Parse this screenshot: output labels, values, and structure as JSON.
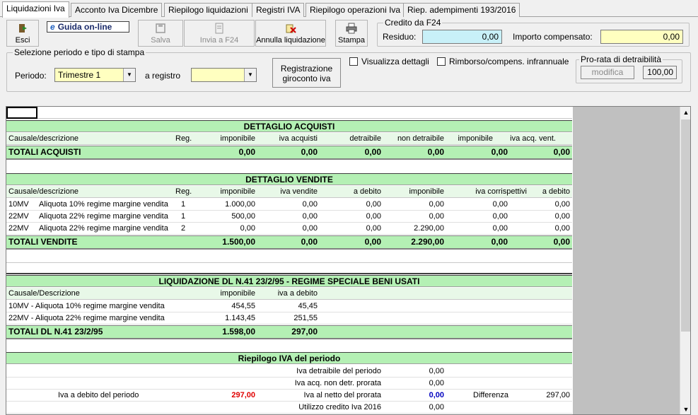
{
  "tabs": [
    {
      "label": "Liquidazioni Iva"
    },
    {
      "label": "Acconto Iva Dicembre"
    },
    {
      "label": "Riepilogo liquidazioni"
    },
    {
      "label": "Registri IVA"
    },
    {
      "label": "Riepilogo operazioni Iva"
    },
    {
      "label": "Riep. adempimenti 193/2016"
    }
  ],
  "toolbar": {
    "esci": "Esci",
    "guida": "Guida on-line",
    "guida_icon": "e",
    "salva": "Salva",
    "invia": "Invia a F24",
    "annulla": "Annulla liquidazione",
    "stampa": "Stampa"
  },
  "credito": {
    "title": "Credito da F24",
    "residuo_label": "Residuo:",
    "residuo_value": "0,00",
    "importo_label": "Importo compensato:",
    "importo_value": "0,00"
  },
  "selezione": {
    "title": "Selezione periodo e tipo di stampa",
    "periodo_label": "Periodo:",
    "periodo_value": "Trimestre 1",
    "registro_label": "a registro",
    "registro_value": "",
    "registrazione_btn_1": "Registrazione",
    "registrazione_btn_2": "giroconto iva",
    "visualizza": "Visualizza dettagli",
    "rimborso": "Rimborso/compens. infrannuale",
    "prorata_title": "Pro-rata di detraibilità",
    "modifica": "modifica",
    "prorata_value": "100,00"
  },
  "acquisti": {
    "title": "DETTAGLIO ACQUISTI",
    "headers": [
      "Causale/descrizione",
      "Reg.",
      "imponibile",
      "iva acquisti",
      "detraibile",
      "non detraibile",
      "imponibile",
      "iva acq. vent."
    ],
    "totals": [
      "TOTALI ACQUISTI",
      "0,00",
      "0,00",
      "0,00",
      "0,00",
      "0,00",
      "0,00"
    ]
  },
  "vendite": {
    "title": "DETTAGLIO VENDITE",
    "headers": [
      "Causale/descrizione",
      "Reg.",
      "imponibile",
      "iva vendite",
      "a debito",
      "imponibile",
      "iva corrispettivi",
      "a debito"
    ],
    "rows": [
      [
        "10MV",
        "Aliquota 10% regime margine vendita",
        "1",
        "1.000,00",
        "0,00",
        "0,00",
        "0,00",
        "0,00",
        "0,00"
      ],
      [
        "22MV",
        "Aliquota 22% regime margine vendita",
        "1",
        "500,00",
        "0,00",
        "0,00",
        "0,00",
        "0,00",
        "0,00"
      ],
      [
        "22MV",
        "Aliquota 22% regime margine vendita",
        "2",
        "0,00",
        "0,00",
        "0,00",
        "2.290,00",
        "0,00",
        "0,00"
      ]
    ],
    "totals": [
      "TOTALI VENDITE",
      "1.500,00",
      "0,00",
      "0,00",
      "2.290,00",
      "0,00",
      "0,00"
    ]
  },
  "dl41": {
    "title": "LIQUIDAZIONE DL N.41 23/2/95 - REGIME SPECIALE BENI USATI",
    "headers": [
      "Causale/Descrizione",
      "imponibile",
      "iva a debito"
    ],
    "rows": [
      [
        "10MV - Aliquota 10% regime margine vendita",
        "454,55",
        "45,45"
      ],
      [
        "22MV - Aliquota 22% regime margine vendita",
        "1.143,45",
        "251,55"
      ]
    ],
    "totals": [
      "TOTALI DL N.41 23/2/95",
      "1.598,00",
      "297,00"
    ]
  },
  "riepilogo": {
    "title": "Riepilogo IVA del periodo",
    "iva_detraibile_label": "Iva detraibile del periodo",
    "iva_detraibile": "0,00",
    "iva_non_detr_label": "Iva acq. non detr. prorata",
    "iva_non_detr": "0,00",
    "iva_debito_label": "Iva a debito del periodo",
    "iva_debito": "297,00",
    "iva_netto_label": "Iva al netto del prorata",
    "iva_netto": "0,00",
    "differenza_label": "Differenza",
    "differenza": "297,00",
    "utilizzo_label": "Utilizzo credito Iva 2016",
    "utilizzo": "0,00"
  }
}
